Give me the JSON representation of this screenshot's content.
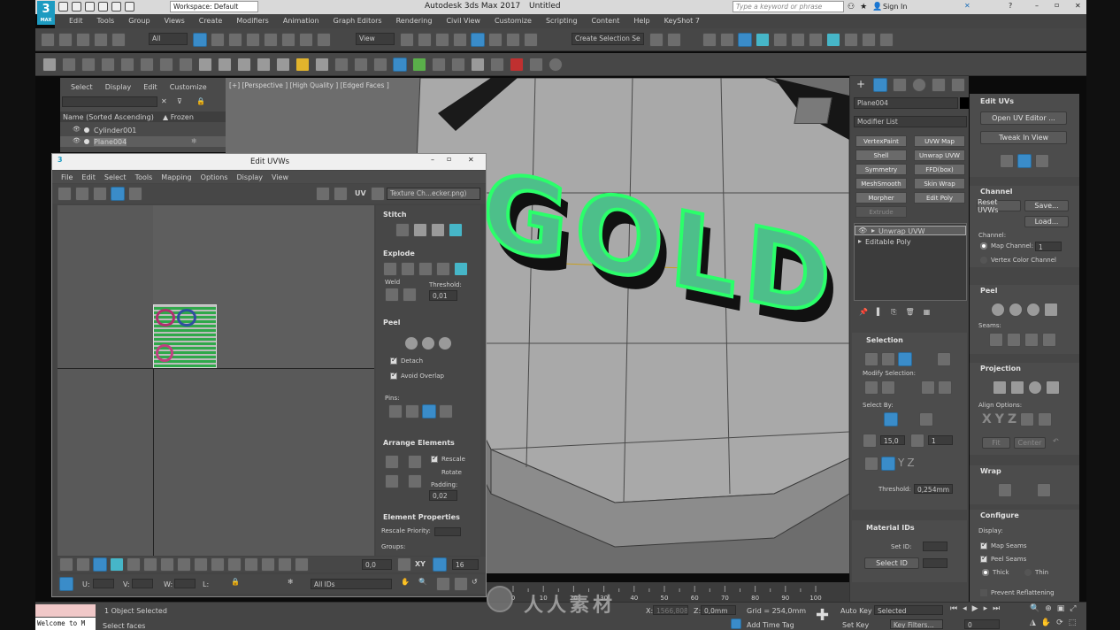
{
  "window": {
    "title": "Autodesk 3ds Max 2017",
    "doc": "Untitled",
    "workspace": "Workspace: Default",
    "search_placeholder": "Type a keyword or phrase",
    "sign_in": "Sign In"
  },
  "menu": [
    "Edit",
    "Tools",
    "Group",
    "Views",
    "Create",
    "Modifiers",
    "Animation",
    "Graph Editors",
    "Rendering",
    "Civil View",
    "Customize",
    "Scripting",
    "Content",
    "Help",
    "KeyShot 7"
  ],
  "toolbar": {
    "filter": "All",
    "view": "View",
    "selection_set": "Create Selection Se"
  },
  "scene_explorer": {
    "tabs": [
      "Select",
      "Display",
      "Edit",
      "Customize"
    ],
    "col_name": "Name (Sorted Ascending)",
    "col_frozen": "▲ Frozen",
    "items": [
      "Cylinder001",
      "Plane004"
    ]
  },
  "viewport": {
    "label": "[+] [Perspective ] [High Quality ] [Edged Faces ]",
    "text3d": "GOLD"
  },
  "uvw": {
    "title": "Edit UVWs",
    "menu": [
      "File",
      "Edit",
      "Select",
      "Tools",
      "Mapping",
      "Options",
      "Display",
      "View"
    ],
    "uv_label": "UV",
    "texture": "Texture Ch...ecker.png)",
    "stitch": "Stitch",
    "explode": "Explode",
    "weld": "Weld",
    "threshold_label": "Threshold:",
    "threshold_value": "0,01",
    "peel": "Peel",
    "detach": "Detach",
    "avoid_overlap": "Avoid Overlap",
    "pins": "Pins:",
    "arrange": "Arrange Elements",
    "rescale": "Rescale",
    "rotate": "Rotate",
    "padding_label": "Padding:",
    "padding_value": "0,02",
    "element_props": "Element Properties",
    "rescale_priority": "Rescale Priority:",
    "groups": "Groups:",
    "angle_value": "0,0",
    "xy": "XY",
    "grid_value": "16",
    "u_label": "U:",
    "v_label": "V:",
    "w_label": "W:",
    "l_label": "L:",
    "all_ids": "All IDs"
  },
  "command_panel": {
    "object_name": "Plane004",
    "modifier_list": "Modifier List",
    "modifiers": [
      "VertexPaint",
      "UVW Map",
      "Shell",
      "Unwrap UVW",
      "Symmetry",
      "FFD(box)",
      "MeshSmooth",
      "Skin Wrap",
      "Morpher",
      "Edit Poly",
      "Extrude"
    ],
    "stack": [
      "Unwrap UVW",
      "Editable Poly"
    ],
    "selection": "Selection",
    "modify_selection": "Modify Selection:",
    "select_by": "Select By:",
    "angle": "15,0",
    "count": "1",
    "threshold_label": "Threshold:",
    "threshold_value": "0,254mm",
    "material_ids": "Material IDs",
    "set_id": "Set ID:",
    "select_id": "Select ID"
  },
  "edit_uvs": {
    "title": "Edit UVs",
    "open_editor": "Open UV Editor ...",
    "tweak": "Tweak In View",
    "channel": "Channel",
    "reset_uvws": "Reset UVWs",
    "save": "Save...",
    "load": "Load...",
    "channel_label": "Channel:",
    "map_channel": "Map Channel:",
    "map_channel_value": "1",
    "vertex_color": "Vertex Color Channel",
    "peel": "Peel",
    "seams": "Seams:",
    "projection": "Projection",
    "align_options": "Align Options:",
    "fit": "Fit",
    "center": "Center",
    "wrap": "Wrap",
    "configure": "Configure",
    "display": "Display:",
    "map_seams": "Map Seams",
    "peel_seams": "Peel Seams",
    "thick": "Thick",
    "thin": "Thin",
    "prevent": "Prevent Reflattening"
  },
  "timeline": {
    "ticks": [
      "0",
      "10",
      "20",
      "30",
      "40",
      "50",
      "60",
      "70",
      "80",
      "90",
      "100"
    ]
  },
  "status": {
    "maxscript": "Welcome to M",
    "objects": "1 Object Selected",
    "prompt": "Select faces",
    "x_label": "X:",
    "x_value": "1566,808m",
    "z_label": "Z:",
    "z_value": "0,0mm",
    "grid": "Grid = 254,0mm",
    "add_time_tag": "Add Time Tag",
    "auto_key": "Auto Key",
    "selected": "Selected",
    "set_key": "Set Key",
    "key_filters": "Key Filters...",
    "frame": "0"
  },
  "watermark": "人人素材"
}
